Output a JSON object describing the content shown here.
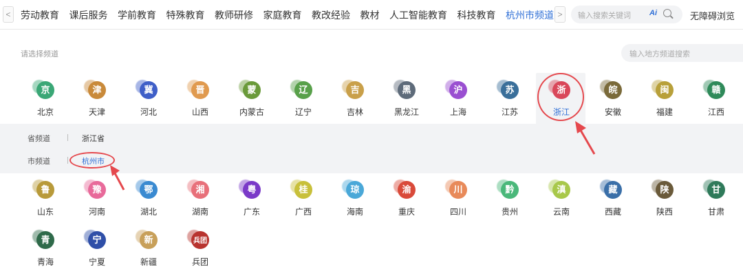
{
  "nav": {
    "items": [
      "劳动教育",
      "课后服务",
      "学前教育",
      "特殊教育",
      "教师研修",
      "家庭教育",
      "教改经验",
      "教材",
      "人工智能教育",
      "科技教育"
    ],
    "active": "杭州市频道",
    "prev": "<",
    "next": ">"
  },
  "search": {
    "placeholder": "输入搜索关键词",
    "ai": "Ai"
  },
  "accessibility": "无障碍浏览",
  "choose_label": "请选择频道",
  "region_search_placeholder": "输入地方频道搜索",
  "provinces_row1": [
    {
      "char": "京",
      "name": "北京",
      "color": "#3aa776"
    },
    {
      "char": "津",
      "name": "天津",
      "color": "#c98a3a"
    },
    {
      "char": "冀",
      "name": "河北",
      "color": "#3f5fc8"
    },
    {
      "char": "晋",
      "name": "山西",
      "color": "#e09a4f"
    },
    {
      "char": "蒙",
      "name": "内蒙古",
      "color": "#6a9a3a"
    },
    {
      "char": "辽",
      "name": "辽宁",
      "color": "#58a04a"
    },
    {
      "char": "吉",
      "name": "吉林",
      "color": "#c9a04a"
    },
    {
      "char": "黑",
      "name": "黑龙江",
      "color": "#5e6b7a"
    },
    {
      "char": "沪",
      "name": "上海",
      "color": "#9a4fd1"
    },
    {
      "char": "苏",
      "name": "江苏",
      "color": "#3a6f9a"
    },
    {
      "char": "浙",
      "name": "浙江",
      "color": "#d9475a"
    },
    {
      "char": "皖",
      "name": "安徽",
      "color": "#7a6a3a"
    },
    {
      "char": "闽",
      "name": "福建",
      "color": "#b8a03a"
    },
    {
      "char": "赣",
      "name": "江西",
      "color": "#2f8a5a"
    }
  ],
  "provinces_row2": [
    {
      "char": "鲁",
      "name": "山东",
      "color": "#b89a3a"
    },
    {
      "char": "豫",
      "name": "河南",
      "color": "#e86a9a"
    },
    {
      "char": "鄂",
      "name": "湖北",
      "color": "#3a8ad1"
    },
    {
      "char": "湘",
      "name": "湖南",
      "color": "#e8707a"
    },
    {
      "char": "粤",
      "name": "广东",
      "color": "#7a3ac8"
    },
    {
      "char": "桂",
      "name": "广西",
      "color": "#c8c03a"
    },
    {
      "char": "琼",
      "name": "海南",
      "color": "#4aa8d8"
    },
    {
      "char": "渝",
      "name": "重庆",
      "color": "#d94a3a"
    },
    {
      "char": "川",
      "name": "四川",
      "color": "#e88a5a"
    },
    {
      "char": "黔",
      "name": "贵州",
      "color": "#4ab87a"
    },
    {
      "char": "滇",
      "name": "云南",
      "color": "#a8c84a"
    },
    {
      "char": "藏",
      "name": "西藏",
      "color": "#3a6fa8"
    },
    {
      "char": "陕",
      "name": "陕西",
      "color": "#6a5a3a"
    },
    {
      "char": "甘",
      "name": "甘肃",
      "color": "#2f7a5a"
    }
  ],
  "provinces_row3": [
    {
      "char": "青",
      "name": "青海",
      "color": "#2f6a4a"
    },
    {
      "char": "宁",
      "name": "宁夏",
      "color": "#2f4fa8"
    },
    {
      "char": "新",
      "name": "新疆",
      "color": "#c8a05a"
    },
    {
      "char": "兵团",
      "name": "兵团",
      "color": "#b8342f"
    }
  ],
  "subpanel": {
    "province_label": "省频道",
    "province_value": "浙江省",
    "city_label": "市频道",
    "city_value": "杭州市"
  },
  "colors": {
    "accent": "#2f6fd6",
    "annotation": "#e5484d"
  }
}
